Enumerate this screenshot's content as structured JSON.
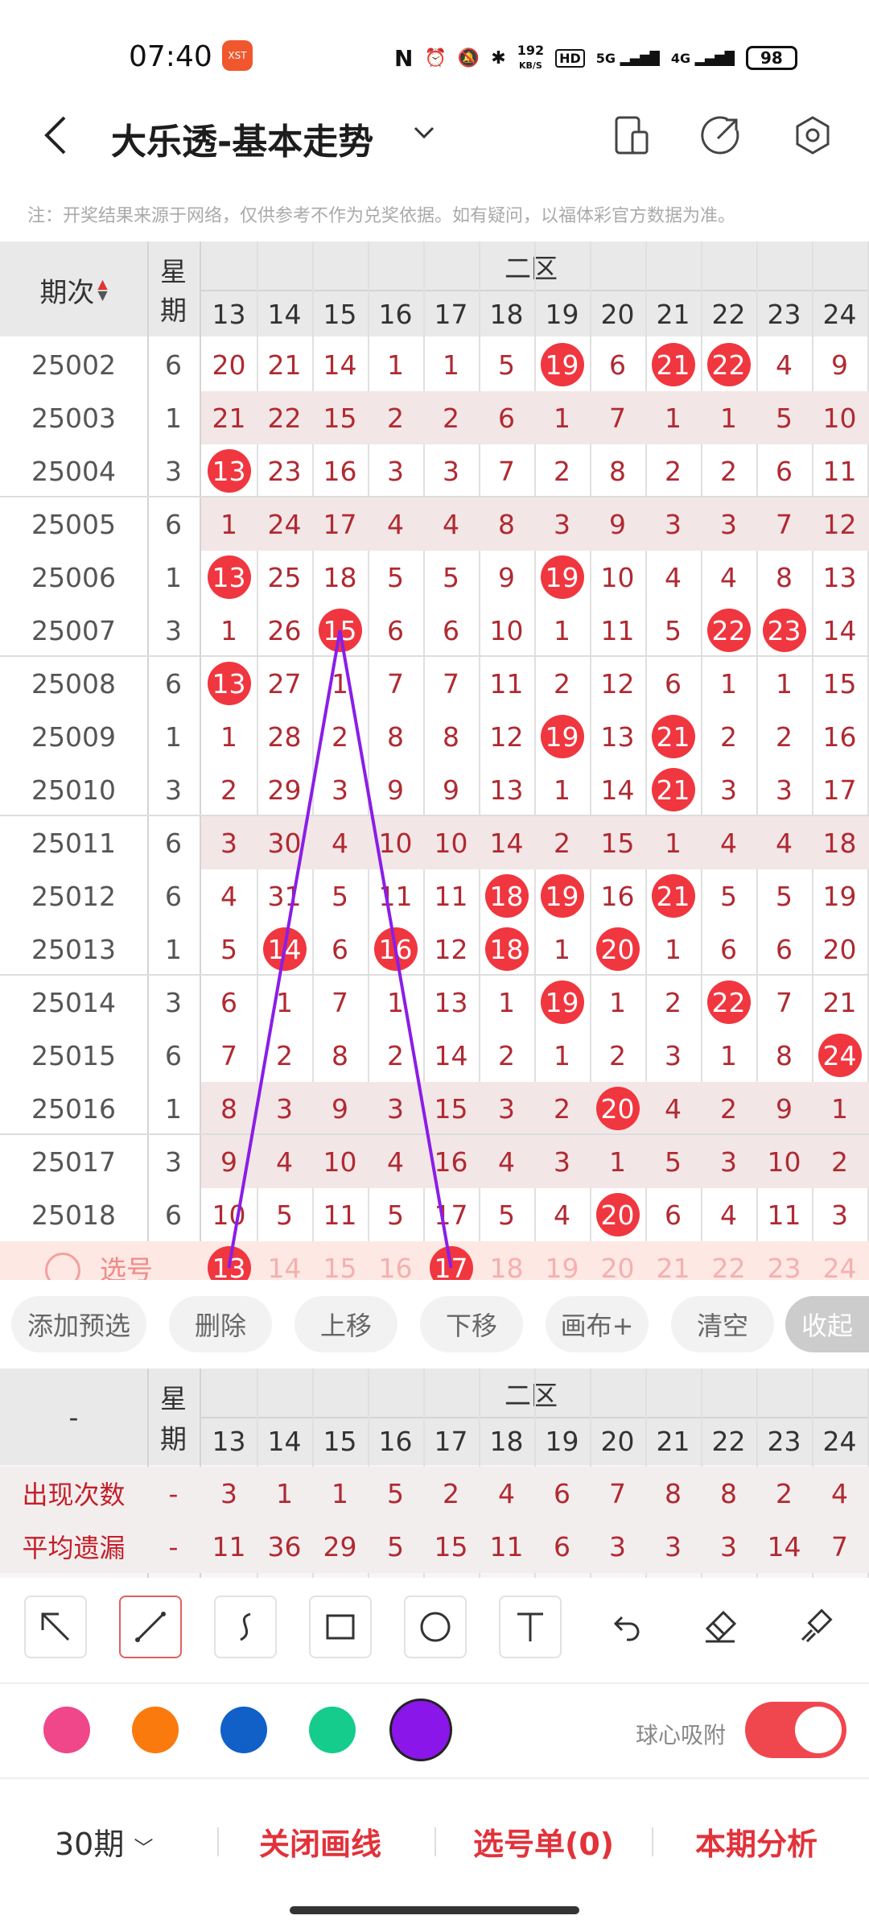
{
  "status_bar": {
    "time": "07:40",
    "app_badge": "XST",
    "speed": "192",
    "speed_unit": "KB/S",
    "hd": "HD",
    "net1": "5G",
    "net2": "4G",
    "battery": "98"
  },
  "header": {
    "title": "大乐透-基本走势",
    "back_icon": "back-arrow-icon",
    "icons": [
      "phone-layout-icon",
      "share-icon",
      "settings-icon"
    ]
  },
  "notice": "注：开奖结果来源于网络，仅供参考不作为兑奖依据。如有疑问，以福体彩官方数据为准。",
  "grid": {
    "period_header": "期次",
    "weekday_header": [
      "星",
      "期"
    ],
    "zone_label": "二区",
    "columns": [
      "13",
      "14",
      "15",
      "16",
      "17",
      "18",
      "19",
      "20",
      "21",
      "22",
      "23",
      "24"
    ],
    "rows": [
      {
        "period": "25002",
        "weekday": "6",
        "cells": [
          "20",
          "21",
          "14",
          "1",
          "1",
          "5",
          "19",
          "6",
          "21",
          "22",
          "4",
          "9"
        ],
        "hits": [
          6,
          8,
          9
        ]
      },
      {
        "period": "25003",
        "weekday": "1",
        "cells": [
          "21",
          "22",
          "15",
          "2",
          "2",
          "6",
          "1",
          "7",
          "1",
          "1",
          "5",
          "10"
        ],
        "hits": []
      },
      {
        "period": "25004",
        "weekday": "3",
        "cells": [
          "13",
          "23",
          "16",
          "3",
          "3",
          "7",
          "2",
          "8",
          "2",
          "2",
          "6",
          "11"
        ],
        "hits": [
          0
        ]
      },
      {
        "period": "25005",
        "weekday": "6",
        "cells": [
          "1",
          "24",
          "17",
          "4",
          "4",
          "8",
          "3",
          "9",
          "3",
          "3",
          "7",
          "12"
        ],
        "hits": []
      },
      {
        "period": "25006",
        "weekday": "1",
        "cells": [
          "13",
          "25",
          "18",
          "5",
          "5",
          "9",
          "19",
          "10",
          "4",
          "4",
          "8",
          "13"
        ],
        "hits": [
          0,
          6
        ]
      },
      {
        "period": "25007",
        "weekday": "3",
        "cells": [
          "1",
          "26",
          "15",
          "6",
          "6",
          "10",
          "1",
          "11",
          "5",
          "22",
          "23",
          "14"
        ],
        "hits": [
          2,
          9,
          10
        ]
      },
      {
        "period": "25008",
        "weekday": "6",
        "cells": [
          "13",
          "27",
          "1",
          "7",
          "7",
          "11",
          "2",
          "12",
          "6",
          "1",
          "1",
          "15"
        ],
        "hits": [
          0
        ]
      },
      {
        "period": "25009",
        "weekday": "1",
        "cells": [
          "1",
          "28",
          "2",
          "8",
          "8",
          "12",
          "19",
          "13",
          "21",
          "2",
          "2",
          "16"
        ],
        "hits": [
          6,
          8
        ]
      },
      {
        "period": "25010",
        "weekday": "3",
        "cells": [
          "2",
          "29",
          "3",
          "9",
          "9",
          "13",
          "1",
          "14",
          "21",
          "3",
          "3",
          "17"
        ],
        "hits": [
          8
        ]
      },
      {
        "period": "25011",
        "weekday": "6",
        "cells": [
          "3",
          "30",
          "4",
          "10",
          "10",
          "14",
          "2",
          "15",
          "1",
          "4",
          "4",
          "18"
        ],
        "hits": []
      },
      {
        "period": "25012",
        "weekday": "6",
        "cells": [
          "4",
          "31",
          "5",
          "11",
          "11",
          "18",
          "19",
          "16",
          "21",
          "5",
          "5",
          "19"
        ],
        "hits": [
          5,
          6,
          8
        ]
      },
      {
        "period": "25013",
        "weekday": "1",
        "cells": [
          "5",
          "14",
          "6",
          "16",
          "12",
          "18",
          "1",
          "20",
          "1",
          "6",
          "6",
          "20"
        ],
        "hits": [
          1,
          3,
          5,
          7
        ]
      },
      {
        "period": "25014",
        "weekday": "3",
        "cells": [
          "6",
          "1",
          "7",
          "1",
          "13",
          "1",
          "19",
          "1",
          "2",
          "22",
          "7",
          "21"
        ],
        "hits": [
          6,
          9
        ]
      },
      {
        "period": "25015",
        "weekday": "6",
        "cells": [
          "7",
          "2",
          "8",
          "2",
          "14",
          "2",
          "1",
          "2",
          "3",
          "1",
          "8",
          "24"
        ],
        "hits": [
          11
        ]
      },
      {
        "period": "25016",
        "weekday": "1",
        "cells": [
          "8",
          "3",
          "9",
          "3",
          "15",
          "3",
          "2",
          "20",
          "4",
          "2",
          "9",
          "1"
        ],
        "hits": [
          7
        ]
      },
      {
        "period": "25017",
        "weekday": "3",
        "cells": [
          "9",
          "4",
          "10",
          "4",
          "16",
          "4",
          "3",
          "1",
          "5",
          "3",
          "10",
          "2"
        ],
        "hits": []
      },
      {
        "period": "25018",
        "weekday": "6",
        "cells": [
          "10",
          "5",
          "11",
          "5",
          "17",
          "5",
          "4",
          "20",
          "6",
          "4",
          "11",
          "3"
        ],
        "hits": [
          7
        ]
      }
    ],
    "pick_row": {
      "label": "选号",
      "cells": [
        "13",
        "14",
        "15",
        "16",
        "17",
        "18",
        "19",
        "20",
        "21",
        "22",
        "23",
        "24"
      ],
      "selected": [
        0,
        4
      ]
    }
  },
  "actions": [
    "添加预选",
    "删除",
    "上移",
    "下移",
    "画布+",
    "清空",
    "收起"
  ],
  "stats": {
    "first_header": "-",
    "rows": [
      {
        "label": "出现次数",
        "weekday": "-",
        "values": [
          "3",
          "1",
          "1",
          "5",
          "2",
          "4",
          "6",
          "7",
          "8",
          "8",
          "2",
          "4"
        ]
      },
      {
        "label": "平均遗漏",
        "weekday": "-",
        "values": [
          "11",
          "36",
          "29",
          "5",
          "15",
          "11",
          "6",
          "3",
          "3",
          "3",
          "14",
          "7"
        ]
      }
    ]
  },
  "tools": [
    "arrow-tool-icon",
    "line-tool-icon",
    "curve-tool-icon",
    "rectangle-tool-icon",
    "circle-tool-icon",
    "text-tool-icon",
    "undo-icon",
    "eraser-icon",
    "clear-brush-icon"
  ],
  "colors": {
    "swatches": [
      "#f0468a",
      "#fa7a0e",
      "#1060c8",
      "#16cc8c",
      "#8a16ea"
    ],
    "selected": 4,
    "line_color": "#8a1ee8",
    "accent": "#f0363f"
  },
  "snap": {
    "label": "球心吸附",
    "on": true
  },
  "bottom": {
    "period_select": "30期",
    "items": [
      "关闭画线",
      "选号单(0)",
      "本期分析"
    ]
  }
}
